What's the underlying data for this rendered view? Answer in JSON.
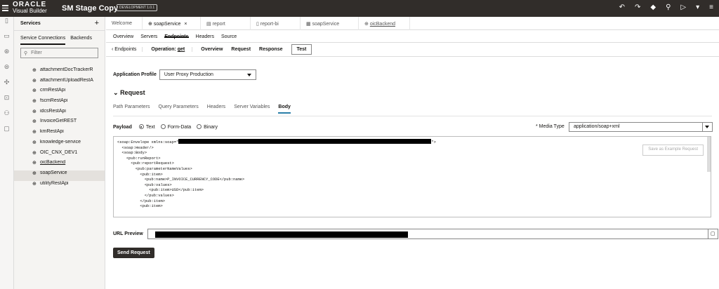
{
  "header": {
    "logo_top": "ORACLE",
    "logo_bottom": "Visual Builder",
    "app_name": "SM Stage Copy",
    "env_badge": "DEVELOPMENT  1.0.1",
    "icons": [
      "undo-icon",
      "redo-icon",
      "diamond-icon",
      "search-icon",
      "run-icon",
      "dropdown-icon",
      "menu-icon"
    ]
  },
  "rail": [
    "page-icon",
    "monitor-icon",
    "services-icon",
    "database-icon",
    "components-icon",
    "flows-icon",
    "people-icon",
    "file-icon"
  ],
  "services": {
    "title": "Services",
    "add": "+",
    "tabs": [
      "Service Connections",
      "Backends"
    ],
    "filter_placeholder": "Filter",
    "items": [
      "attachmentDocTrackerR",
      "attachmentUploadRestA",
      "crmRestApi",
      "fscmRestApi",
      "idcsRestApi",
      "InvoiceGetREST",
      "kmRestApi",
      "knowledge-service",
      "OIC_CNX_DEV1",
      "oicBackend",
      "soapService",
      "utilityRestApi"
    ],
    "selected_index": 10
  },
  "doc_tabs": [
    {
      "label": "Welcome",
      "icon": ""
    },
    {
      "label": "soapService",
      "icon": "⊕",
      "close": "×"
    },
    {
      "label": "report",
      "icon": "▤"
    },
    {
      "label": "report-bi",
      "icon": "▯"
    },
    {
      "label": "soapService",
      "icon": "▦"
    },
    {
      "label": "oicBackend",
      "icon": "⊕"
    }
  ],
  "sub_tabs": [
    "Overview",
    "Servers",
    "Endpoints",
    "Headers",
    "Source"
  ],
  "endpoint_bar": {
    "back": "‹ Endpoints",
    "operation_label": "Operation:",
    "operation_value": "get",
    "tabs": [
      "Overview",
      "Request",
      "Response",
      "Test"
    ]
  },
  "profile": {
    "label": "Application Profile",
    "value": "User Proxy Production"
  },
  "request": {
    "heading": "Request",
    "tabs": [
      "Path Parameters",
      "Query Parameters",
      "Headers",
      "Server Variables",
      "Body"
    ],
    "payload_label": "Payload",
    "payload_options": [
      "Text",
      "Form-Data",
      "Binary"
    ],
    "media_type_label": "* Media Type",
    "media_type_value": "application/soap+xml",
    "body_lines": [
      "<soap:Envelope xmlns:soap=\"",
      "  <soap:Header/>",
      "  <soap:Body>",
      "    <pub:runReport>",
      "      <pub:reportRequest>",
      "        <pub:parameterNameValues>",
      "          <pub:item>",
      "            <pub:name>P_INVOICE_CURRENCY_CODE</pub:name>",
      "            <pub:values>",
      "              <pub:item>USD</pub:item>",
      "            </pub:values>",
      "          </pub:item>",
      "          <pub:item>"
    ],
    "envelope_suffix": "\">",
    "save_example": "Save as Example Request",
    "url_label": "URL Preview",
    "send": "Send Request"
  }
}
